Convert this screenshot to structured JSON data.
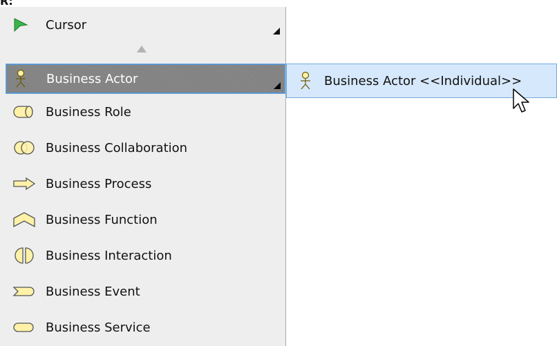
{
  "top_fragment": "R:",
  "palette": {
    "cursor": {
      "label": "Cursor",
      "icon": "cursor-arrow-icon"
    },
    "selected": {
      "label": "Business Actor",
      "icon": "business-actor-icon"
    },
    "items": [
      {
        "label": "Business Role",
        "icon": "business-role-icon"
      },
      {
        "label": "Business Collaboration",
        "icon": "business-collaboration-icon"
      },
      {
        "label": "Business Process",
        "icon": "business-process-icon"
      },
      {
        "label": "Business Function",
        "icon": "business-function-icon"
      },
      {
        "label": "Business Interaction",
        "icon": "business-interaction-icon"
      },
      {
        "label": "Business Event",
        "icon": "business-event-icon"
      },
      {
        "label": "Business Service",
        "icon": "business-service-icon"
      }
    ]
  },
  "popup": {
    "label": "Business Actor <<Individual>>",
    "icon": "business-actor-icon"
  },
  "colors": {
    "panel_bg": "#eeeeee",
    "selected_bg": "#808080",
    "popup_bg": "#d6e8fb",
    "accent_border": "#6fa8dc",
    "icon_yellow": "#fff2a8",
    "cursor_green": "#39b54a"
  }
}
